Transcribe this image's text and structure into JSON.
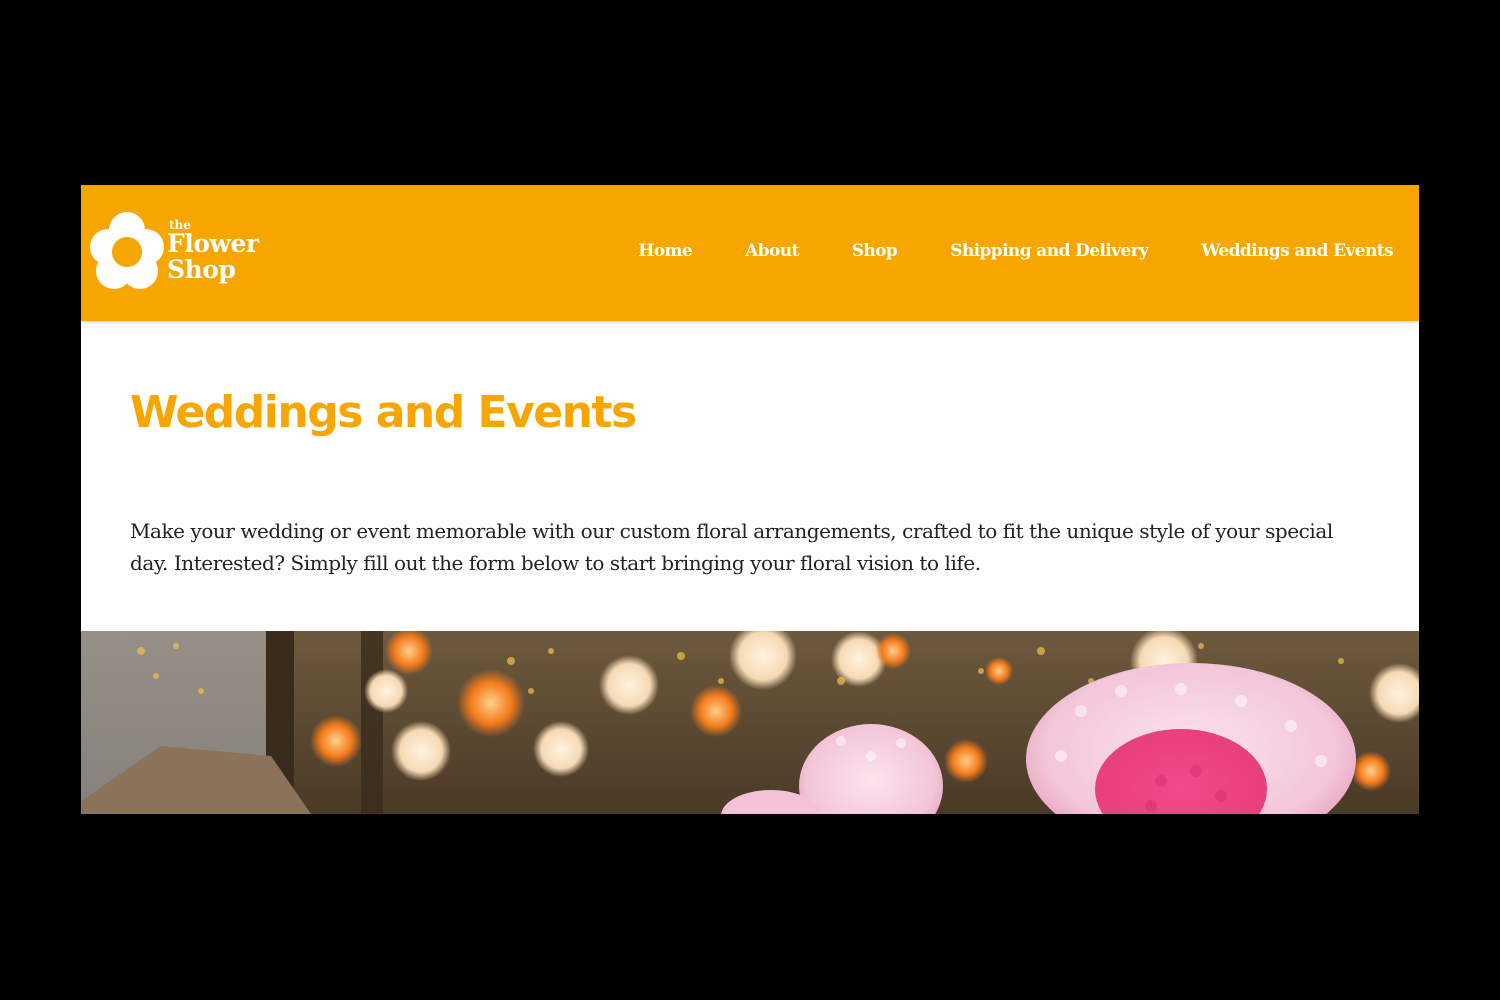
{
  "header": {
    "background_color": "#f7a600",
    "logo": {
      "the": "the",
      "flower": "Flower",
      "shop": "Shop"
    },
    "nav": [
      {
        "label": "Home"
      },
      {
        "label": "About"
      },
      {
        "label": "Shop"
      },
      {
        "label": "Shipping and Delivery"
      },
      {
        "label": "Weddings and Events"
      }
    ]
  },
  "main": {
    "title": "Weddings and Events",
    "title_color": "#f7a600",
    "intro": "Make your wedding or event memorable with our custom floral arrangements, crafted to fit the unique style of your special day. Interested? Simply fill out the form below to start bringing your floral vision to life."
  },
  "hero_image": {
    "subject": "pink-hydrangea-bouquets-with-bokeh-lights"
  }
}
